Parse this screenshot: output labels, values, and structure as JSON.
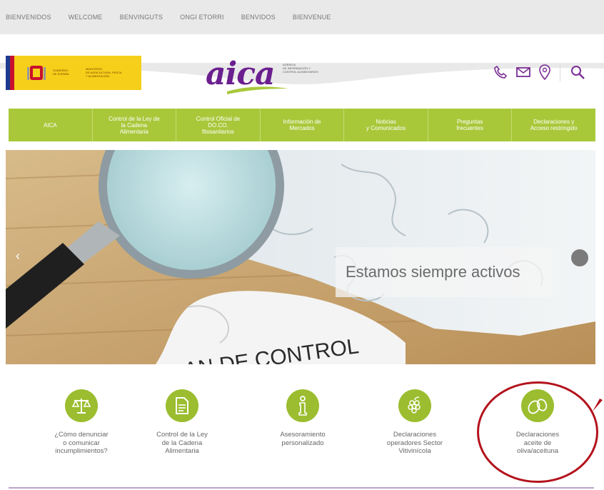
{
  "languages": [
    "BIENVENIDOS",
    "WELCOME",
    "BENVINGUTS",
    "ONGI ETORRI",
    "BENVIDOS",
    "BIENVENUE"
  ],
  "header": {
    "gov_text": [
      "GOBIERNO",
      "DE ESPAÑA"
    ],
    "ministry_text": [
      "MINISTERIO",
      "DE AGRICULTURA, PESCA",
      "Y ALIMENTACIÓN"
    ],
    "aica_word": "aica",
    "aica_subtitle": [
      "AGENCIA",
      "DE INFORMACIÓN Y",
      "CONTROL ALIMENTARIOS"
    ],
    "icons": [
      "phone-icon",
      "mail-icon",
      "location-icon",
      "search-icon"
    ]
  },
  "nav": [
    "AICA",
    "Control de la Ley de\nla Cadena\nAlimentaria",
    "Control Oficial de\nDO.CO.\nfitosanitarios",
    "Información de\nMercados",
    "Noticias\ny Comunicados",
    "Preguntas\nfrecuentes",
    "Declaraciones y\nAcceso restringido"
  ],
  "hero": {
    "caption": "Estamos siempre activos",
    "puzzle_text": "AN DE CONTROL"
  },
  "features": [
    {
      "label": "¿Cómo denunciar\no comunicar\nincumplimientos?",
      "icon": "scales-icon"
    },
    {
      "label": "Control de la Ley\nde la Cadena\nAlimentaria",
      "icon": "document-icon"
    },
    {
      "label": "Asesoramiento\npersonalizado",
      "icon": "info-icon"
    },
    {
      "label": "Declaraciones\noperadores Sector\nVitivinícola",
      "icon": "grapes-icon"
    },
    {
      "label": "Declaraciones\naceite de\noliva/aceituna",
      "icon": "olive-icon"
    }
  ],
  "colors": {
    "accent": "#9bbd2f",
    "nav": "#a8c83a",
    "brand": "#6b1f8f",
    "highlight": "#b3131d"
  }
}
